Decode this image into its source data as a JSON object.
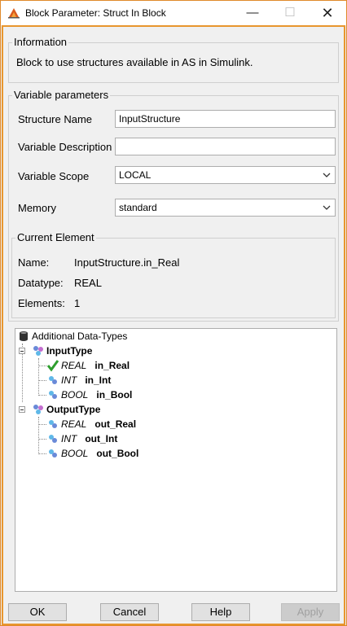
{
  "window": {
    "title": "Block Parameter: Struct In Block",
    "minimize_glyph": "—",
    "maximize_glyph": "☐",
    "close_glyph": "✕"
  },
  "information": {
    "title": "Information",
    "text": "Block to use structures available in AS in Simulink."
  },
  "variable_parameters": {
    "title": "Variable parameters",
    "structure_name_label": "Structure Name",
    "structure_name_value": "InputStructure",
    "variable_description_label": "Variable Description",
    "variable_description_value": "",
    "variable_scope_label": "Variable Scope",
    "variable_scope_value": "LOCAL",
    "memory_label": "Memory",
    "memory_value": "standard"
  },
  "current_element": {
    "title": "Current Element",
    "name_label": "Name:",
    "name_value": "InputStructure.in_Real",
    "datatype_label": "Datatype:",
    "datatype_value": "REAL",
    "elements_label": "Elements:",
    "elements_value": "1"
  },
  "tree": {
    "root": "Additional Data-Types",
    "input_type": {
      "label": "InputType",
      "children": [
        {
          "type": "REAL",
          "name": "in_Real",
          "selected": true
        },
        {
          "type": "INT",
          "name": "in_Int"
        },
        {
          "type": "BOOL",
          "name": "in_Bool"
        }
      ]
    },
    "output_type": {
      "label": "OutputType",
      "children": [
        {
          "type": "REAL",
          "name": "out_Real"
        },
        {
          "type": "INT",
          "name": "out_Int"
        },
        {
          "type": "BOOL",
          "name": "out_Bool"
        }
      ]
    }
  },
  "buttons": {
    "ok": "OK",
    "cancel": "Cancel",
    "help": "Help",
    "apply": "Apply"
  },
  "colors": {
    "focus_border": "#e8962e",
    "check_green": "#2e9e2e"
  }
}
